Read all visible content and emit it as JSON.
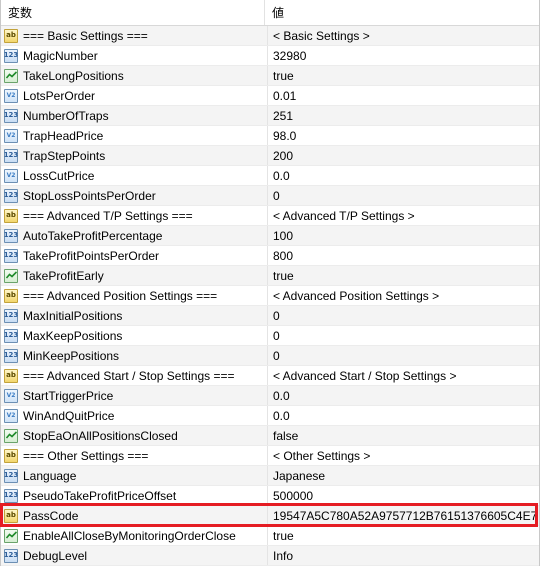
{
  "header": {
    "col_variable": "変数",
    "col_value": "値"
  },
  "rows": [
    {
      "type": "str",
      "name": "=== Basic Settings ===",
      "value": "< Basic Settings >"
    },
    {
      "type": "int",
      "name": "MagicNumber",
      "value": "32980"
    },
    {
      "type": "bool",
      "name": "TakeLongPositions",
      "value": "true"
    },
    {
      "type": "dbl",
      "name": "LotsPerOrder",
      "value": "0.01"
    },
    {
      "type": "int",
      "name": "NumberOfTraps",
      "value": "251"
    },
    {
      "type": "dbl",
      "name": "TrapHeadPrice",
      "value": "98.0"
    },
    {
      "type": "int",
      "name": "TrapStepPoints",
      "value": "200"
    },
    {
      "type": "dbl",
      "name": "LossCutPrice",
      "value": "0.0"
    },
    {
      "type": "int",
      "name": "StopLossPointsPerOrder",
      "value": "0"
    },
    {
      "type": "str",
      "name": "=== Advanced T/P Settings ===",
      "value": "< Advanced T/P Settings >"
    },
    {
      "type": "int",
      "name": "AutoTakeProfitPercentage",
      "value": "100"
    },
    {
      "type": "int",
      "name": "TakeProfitPointsPerOrder",
      "value": "800"
    },
    {
      "type": "bool",
      "name": "TakeProfitEarly",
      "value": "true"
    },
    {
      "type": "str",
      "name": "=== Advanced Position Settings ===",
      "value": "< Advanced Position Settings >"
    },
    {
      "type": "int",
      "name": "MaxInitialPositions",
      "value": "0"
    },
    {
      "type": "int",
      "name": "MaxKeepPositions",
      "value": "0"
    },
    {
      "type": "int",
      "name": "MinKeepPositions",
      "value": "0"
    },
    {
      "type": "str",
      "name": "=== Advanced Start / Stop Settings ===",
      "value": "< Advanced Start / Stop Settings >"
    },
    {
      "type": "dbl",
      "name": "StartTriggerPrice",
      "value": "0.0"
    },
    {
      "type": "dbl",
      "name": "WinAndQuitPrice",
      "value": "0.0"
    },
    {
      "type": "bool",
      "name": "StopEaOnAllPositionsClosed",
      "value": "false"
    },
    {
      "type": "str",
      "name": "=== Other Settings ===",
      "value": "< Other Settings >"
    },
    {
      "type": "int",
      "name": "Language",
      "value": "Japanese"
    },
    {
      "type": "int",
      "name": "PseudoTakeProfitPriceOffset",
      "value": "500000"
    },
    {
      "type": "str",
      "name": "PassCode",
      "value": "19547A5C780A52A9757712B76151376605C4E7"
    },
    {
      "type": "bool",
      "name": "EnableAllCloseByMonitoringOrderClose",
      "value": "true"
    },
    {
      "type": "int",
      "name": "DebugLevel",
      "value": "Info"
    }
  ],
  "icon_glyphs": {
    "int": "123",
    "dbl": "V2",
    "str": "ab"
  },
  "highlight_color": "#e51c23"
}
